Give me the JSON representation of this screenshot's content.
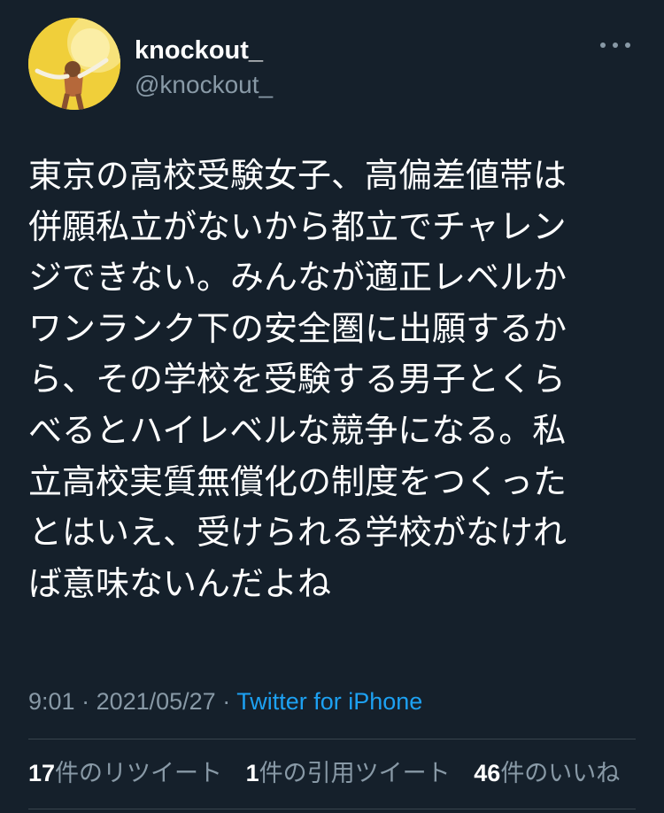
{
  "user": {
    "display_name": "knockout_",
    "handle": "@knockout_"
  },
  "tweet": {
    "lines": [
      "東京の高校受験女子、高偏差値帯は",
      "併願私立がないから都立でチャレン",
      "ジできない。みんなが適正レベルか",
      "ワンランク下の安全圏に出願するか",
      "ら、その学校を受験する男子とくら",
      "べるとハイレベルな競争になる。私",
      "立高校実質無償化の制度をつくった",
      "とはいえ、受けられる学校がなけれ",
      "ば意味ないんだよね"
    ]
  },
  "meta": {
    "time": "9:01",
    "separator": " · ",
    "date": "2021/05/27",
    "source": "Twitter for iPhone"
  },
  "stats": {
    "retweets_count": "17",
    "retweets_label": "件のリツイート",
    "quotes_count": "1",
    "quotes_label": "件の引用ツイート",
    "likes_count": "46",
    "likes_label": "件のいいね"
  },
  "icons": {
    "more": "more-horizontal-icon",
    "avatar": "profile-avatar"
  },
  "colors": {
    "background": "#15202b",
    "secondary_text": "#8899a6",
    "link": "#1da1f2",
    "divider": "#38444d"
  }
}
